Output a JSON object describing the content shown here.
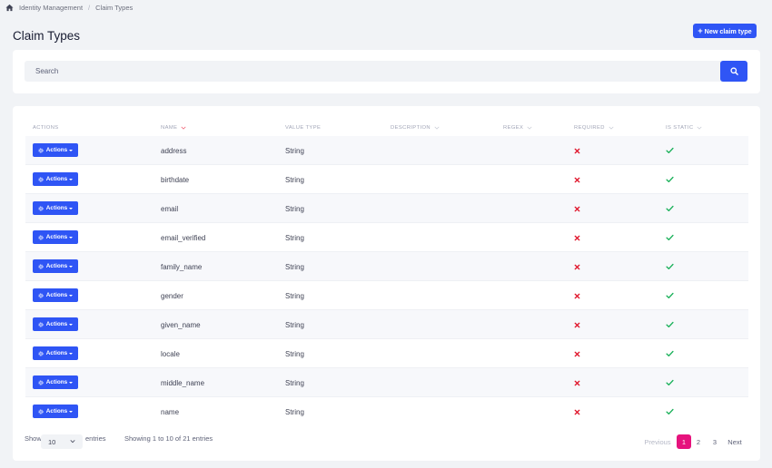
{
  "breadcrumb": {
    "items": [
      "Identity Management",
      "Claim Types"
    ]
  },
  "page": {
    "title": "Claim Types",
    "new_button": "New claim type"
  },
  "search": {
    "placeholder": "Search"
  },
  "table": {
    "headers": [
      "ACTIONS",
      "NAME",
      "VALUE TYPE",
      "DESCRIPTION",
      "REGEX",
      "REQUIRED",
      "IS STATIC"
    ],
    "action_label": "Actions",
    "rows": [
      {
        "name": "address",
        "value_type": "String",
        "description": "",
        "regex": "",
        "required": false,
        "is_static": true
      },
      {
        "name": "birthdate",
        "value_type": "String",
        "description": "",
        "regex": "",
        "required": false,
        "is_static": true
      },
      {
        "name": "email",
        "value_type": "String",
        "description": "",
        "regex": "",
        "required": false,
        "is_static": true
      },
      {
        "name": "email_verified",
        "value_type": "String",
        "description": "",
        "regex": "",
        "required": false,
        "is_static": true
      },
      {
        "name": "family_name",
        "value_type": "String",
        "description": "",
        "regex": "",
        "required": false,
        "is_static": true
      },
      {
        "name": "gender",
        "value_type": "String",
        "description": "",
        "regex": "",
        "required": false,
        "is_static": true
      },
      {
        "name": "given_name",
        "value_type": "String",
        "description": "",
        "regex": "",
        "required": false,
        "is_static": true
      },
      {
        "name": "locale",
        "value_type": "String",
        "description": "",
        "regex": "",
        "required": false,
        "is_static": true
      },
      {
        "name": "middle_name",
        "value_type": "String",
        "description": "",
        "regex": "",
        "required": false,
        "is_static": true
      },
      {
        "name": "name",
        "value_type": "String",
        "description": "",
        "regex": "",
        "required": false,
        "is_static": true
      }
    ]
  },
  "footer": {
    "show_label": "Show",
    "page_size": "10",
    "entries_label": "entries",
    "info": "Showing 1 to 10 of 21 entries"
  },
  "pagination": {
    "previous": "Previous",
    "pages": [
      "1",
      "2",
      "3"
    ],
    "active_page": "1",
    "next": "Next"
  },
  "colors": {
    "primary": "#2f55f5",
    "active_page": "#e6137d",
    "cross": "#e0152b",
    "check": "#1bb15a"
  }
}
